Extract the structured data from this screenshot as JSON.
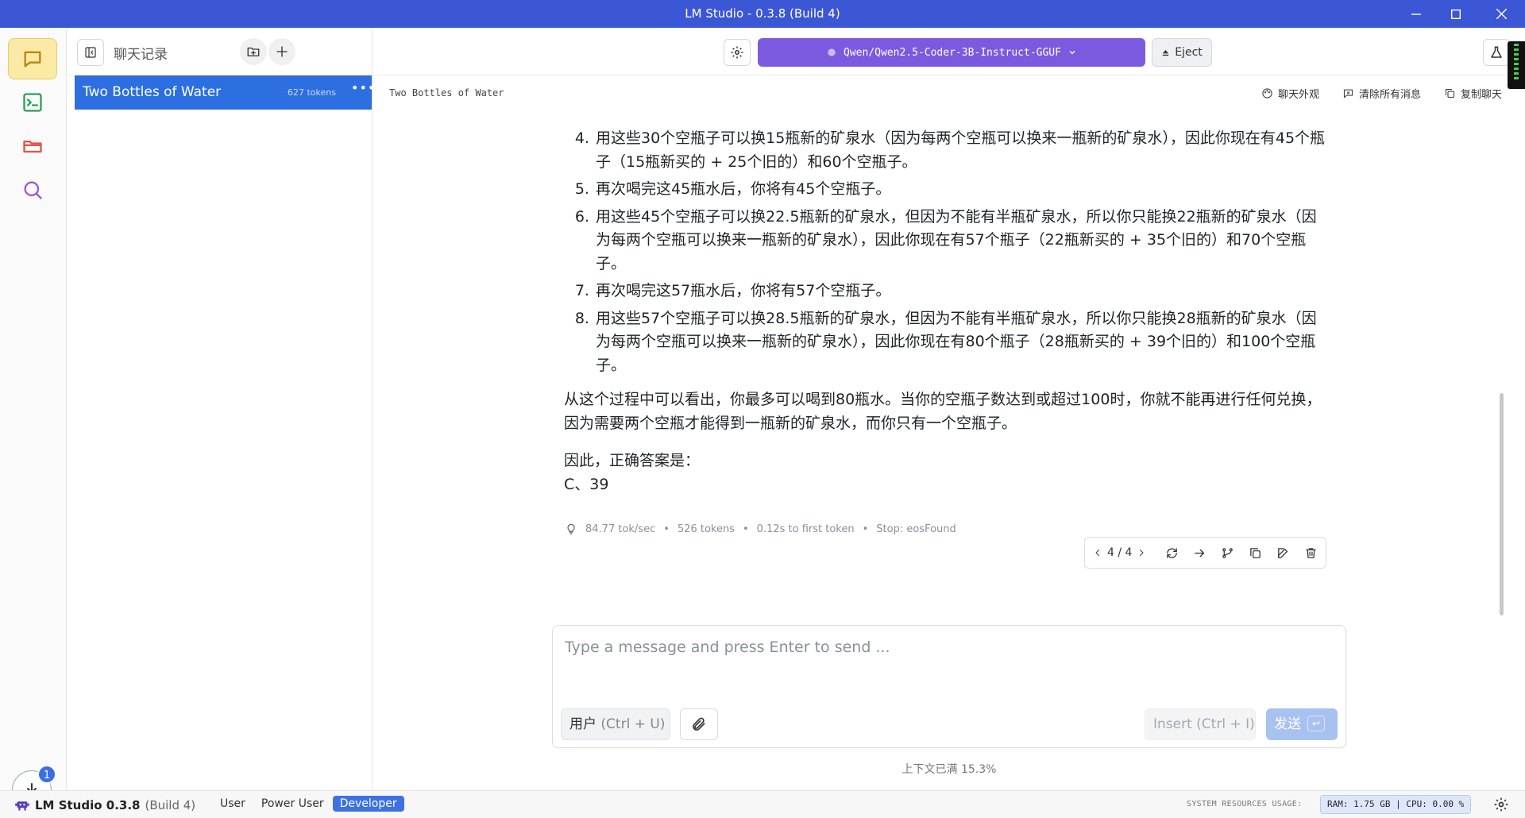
{
  "window": {
    "title": "LM Studio - 0.3.8 (Build 4)"
  },
  "chats_panel": {
    "title": "聊天记录",
    "items": [
      {
        "name": "Two Bottles of Water",
        "tokens": "627 tokens"
      }
    ]
  },
  "toolbar": {
    "model": "Qwen/Qwen2.5-Coder-3B-Instruct-GGUF",
    "eject_label": "Eject"
  },
  "chat_header": {
    "name": "Two Bottles of Water",
    "appearance_label": "聊天外观",
    "clear_label": "清除所有消息",
    "copy_label": "复制聊天"
  },
  "message": {
    "steps": [
      {
        "n": "4.",
        "text": "用这些30个空瓶子可以换15瓶新的矿泉水（因为每两个空瓶可以换来一瓶新的矿泉水），因此你现在有45个瓶子（15瓶新买的 + 25个旧的）和60个空瓶子。"
      },
      {
        "n": "5.",
        "text": "再次喝完这45瓶水后，你将有45个空瓶子。"
      },
      {
        "n": "6.",
        "text": "用这些45个空瓶子可以换22.5瓶新的矿泉水，但因为不能有半瓶矿泉水，所以你只能换22瓶新的矿泉水（因为每两个空瓶可以换来一瓶新的矿泉水），因此你现在有57个瓶子（22瓶新买的 + 35个旧的）和70个空瓶子。"
      },
      {
        "n": "7.",
        "text": "再次喝完这57瓶水后，你将有57个空瓶子。"
      },
      {
        "n": "8.",
        "text": "用这些57个空瓶子可以换28.5瓶新的矿泉水，但因为不能有半瓶矿泉水，所以你只能换28瓶新的矿泉水（因为每两个空瓶可以换来一瓶新的矿泉水），因此你现在有80个瓶子（28瓶新买的 + 39个旧的）和100个空瓶子。"
      }
    ],
    "conclusion": "从这个过程中可以看出，你最多可以喝到80瓶水。当你的空瓶子数达到或超过100时，你就不能再进行任何兑换，因为需要两个空瓶才能得到一瓶新的矿泉水，而你只有一个空瓶子。",
    "answer_intro": "因此，正确答案是：",
    "answer": "C、39",
    "stats": {
      "speed": "84.77 tok/sec",
      "tokens": "526 tokens",
      "first_token": "0.12s to first token",
      "stop": "Stop: eosFound"
    },
    "version_nav": "4 / 4"
  },
  "composer": {
    "placeholder": "Type a message and press Enter to send ...",
    "role_label": "用户",
    "role_hint": "(Ctrl + U)",
    "insert_label": "Insert",
    "insert_hint": "(Ctrl + I)",
    "send_label": "发送",
    "send_key": "↩"
  },
  "context": "上下文已满 15.3%",
  "statusbar": {
    "app": "LM Studio 0.3.8",
    "build": "(Build 4)",
    "modes": [
      "User",
      "Power User",
      "Developer"
    ],
    "active_mode": "Developer",
    "resources_label": "SYSTEM RESOURCES USAGE:",
    "ram": "RAM: 1.75 GB",
    "cpu": "CPU: 0.00 %"
  },
  "downloads_badge": "1",
  "colors": {
    "titlebar": "#3b57d6",
    "model_button": "#7b5ae0",
    "selected_chat": "#2d6fe0",
    "active_rail": "#fbeaa6"
  },
  "icons": [
    "chat-icon",
    "terminal-icon",
    "folder-icon",
    "search-icon",
    "download-icon",
    "sidebar-toggle-icon",
    "new-folder-icon",
    "plus-icon",
    "gear-icon",
    "flask-icon",
    "palette-icon",
    "clear-icon",
    "copy-icon",
    "lightbulb-icon",
    "regenerate-icon",
    "continue-icon",
    "branch-icon",
    "edit-icon",
    "trash-icon",
    "paperclip-icon"
  ]
}
